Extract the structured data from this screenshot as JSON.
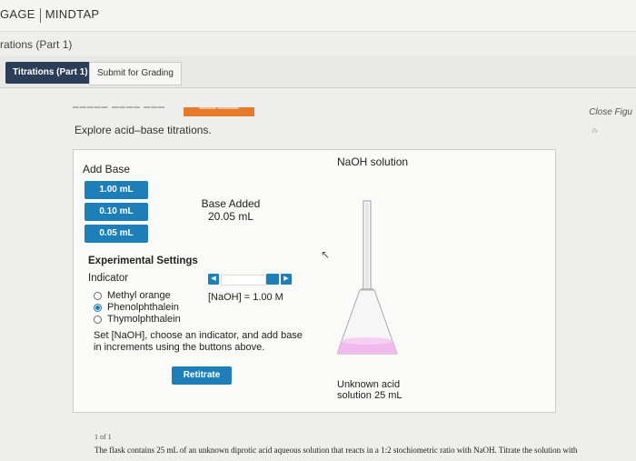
{
  "header": {
    "brand_left": "GAGE",
    "brand_right": "MINDTAP"
  },
  "breadcrumb": "rations (Part 1)",
  "tabs": [
    {
      "label": "Titrations (Part 1)",
      "active": true
    },
    {
      "label": "Submit for Grading",
      "active": false
    }
  ],
  "top": {
    "close_link": "Close Figu"
  },
  "intro": "Explore acid–base titrations.",
  "simulation": {
    "add_base_label": "Add Base",
    "increments": [
      "1.00 mL",
      "0.10 mL",
      "0.05 mL"
    ],
    "base_added_label": "Base Added",
    "base_added_value": "20.05 mL",
    "settings_title": "Experimental Settings",
    "indicator_label": "Indicator",
    "indicators": [
      {
        "label": "Methyl orange",
        "selected": false
      },
      {
        "label": "Phenolphthalein",
        "selected": true
      },
      {
        "label": "Thymolphthalein",
        "selected": false
      }
    ],
    "naoh_concentration": "[NaOH] = 1.00 M",
    "instructions": "Set [NaOH], choose an indicator, and add base in increments using the buttons above.",
    "retitrate_label": "Retitrate",
    "naoh_solution_label": "NaOH solution",
    "unknown_acid_label": "Unknown acid",
    "unknown_acid_volume": "solution 25 mL",
    "solution_color": "#f2b9ee",
    "accent_color": "#1e7fb8"
  },
  "footer": {
    "page": "1 of 1",
    "text": "The flask contains 25 mL of an unknown diprotic acid aqueous solution that reacts in a 1:2 stochiometric ratio with NaOH. Titrate the solution with"
  }
}
